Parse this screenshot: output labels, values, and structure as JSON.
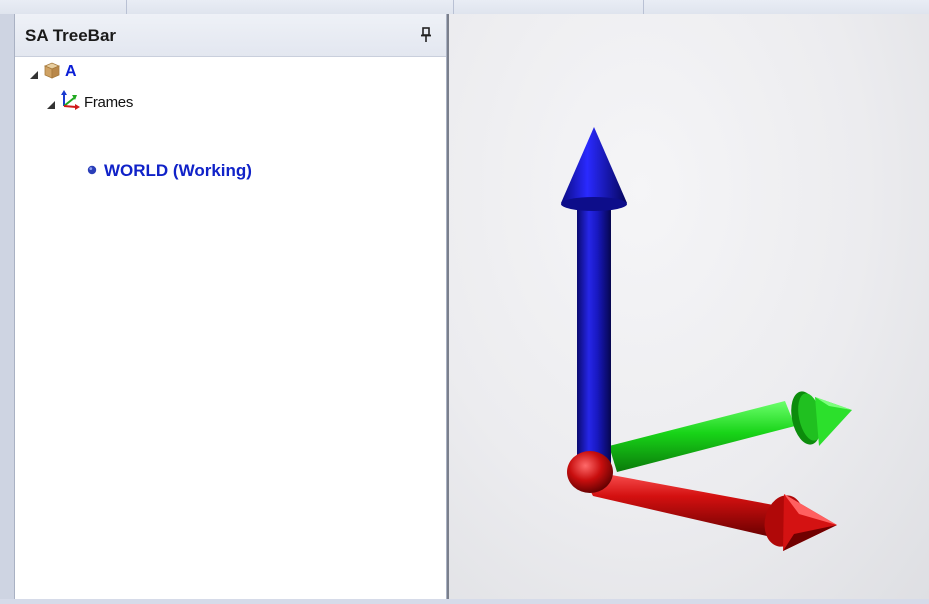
{
  "treebar": {
    "title": "SA TreeBar",
    "pin_icon": "pin-icon"
  },
  "tree": {
    "root": {
      "label": "A",
      "icon": "box-icon",
      "color": "#0a1ed6"
    },
    "frames": {
      "label": "Frames",
      "icon": "axes-icon"
    },
    "world": {
      "label": "WORLD (Working)",
      "icon": "bullet-icon",
      "color": "#1022c8"
    }
  },
  "viewport": {
    "axes": [
      {
        "axis": "z",
        "color": "#1414b4"
      },
      {
        "axis": "y",
        "color": "#18c818"
      },
      {
        "axis": "x",
        "color": "#c81010"
      }
    ]
  }
}
